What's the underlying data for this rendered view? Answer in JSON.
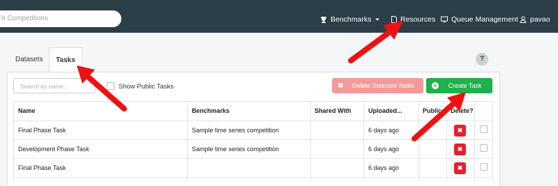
{
  "navbar": {
    "search_placeholder": "h Competitions",
    "benchmarks_label": "Benchmarks",
    "resources_label": "Resources",
    "queue_label": "Queue Management",
    "user_label": "pavao"
  },
  "tabs": {
    "datasets": "Datasets",
    "tasks": "Tasks"
  },
  "help_label": "?",
  "toolbar": {
    "search_placeholder": "Search by name...",
    "show_public_label": "Show Public Tasks",
    "delete_selected_label": "Delete Selected Tasks",
    "create_task_label": "Create Task"
  },
  "table": {
    "headers": [
      "Name",
      "Benchmarks",
      "Shared With",
      "Uploaded...",
      "Public",
      "Delete?"
    ],
    "rows": [
      {
        "name": "Final Phase Task",
        "benchmark": "Sample time series competition",
        "shared_with": "",
        "uploaded": "6 days ago"
      },
      {
        "name": "Development Phase Task",
        "benchmark": "Sample time series competition",
        "shared_with": "",
        "uploaded": "6 days ago"
      },
      {
        "name": "Final Phase Task",
        "benchmark": "",
        "shared_with": "",
        "uploaded": "6 days ago"
      }
    ]
  },
  "colors": {
    "navbar_bg": "#2c3e47",
    "create_green": "#1fb14b",
    "delete_red": "#e8202b",
    "delete_selected_pink": "#f49a9b",
    "annotation_arrow": "#ee1111"
  }
}
